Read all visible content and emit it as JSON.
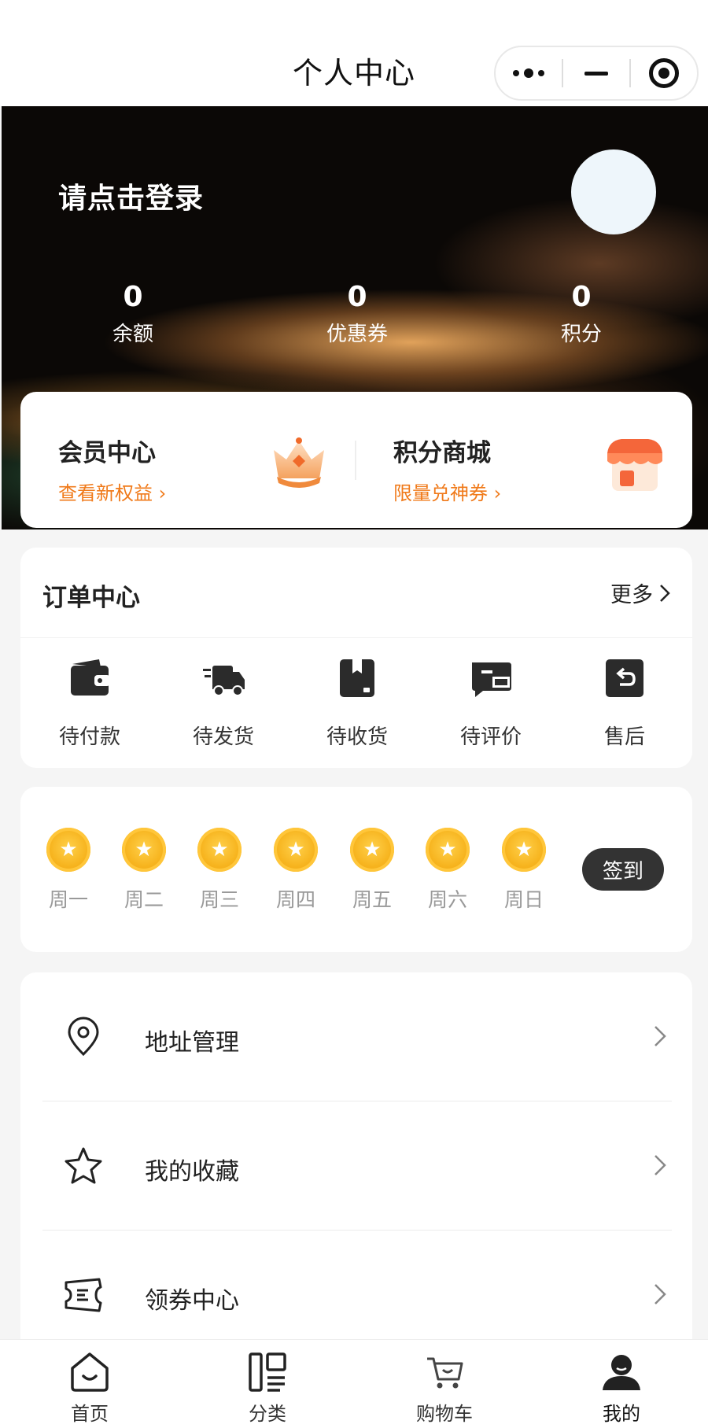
{
  "nav": {
    "title": "个人中心"
  },
  "hero": {
    "login_text": "请点击登录",
    "stats": [
      {
        "value": "0",
        "label": "余额"
      },
      {
        "value": "0",
        "label": "优惠券"
      },
      {
        "value": "0",
        "label": "积分"
      }
    ]
  },
  "member": {
    "vip": {
      "title": "会员中心",
      "subtitle": "查看新权益",
      "icon": "crown-icon"
    },
    "mall": {
      "title": "积分商城",
      "subtitle": "限量兑神券",
      "icon": "shop-icon"
    }
  },
  "orders": {
    "title": "订单中心",
    "more": "更多",
    "items": [
      {
        "label": "待付款",
        "icon": "wallet-icon"
      },
      {
        "label": "待发货",
        "icon": "truck-icon"
      },
      {
        "label": "待收货",
        "icon": "package-icon"
      },
      {
        "label": "待评价",
        "icon": "review-icon"
      },
      {
        "label": "售后",
        "icon": "return-icon"
      }
    ]
  },
  "signin": {
    "days": [
      "周一",
      "周二",
      "周三",
      "周四",
      "周五",
      "周六",
      "周日"
    ],
    "button": "签到",
    "colors": {
      "coin": "#f7b520",
      "button": "#333333"
    }
  },
  "menu": [
    {
      "label": "地址管理",
      "icon": "location-pin-icon"
    },
    {
      "label": "我的收藏",
      "icon": "star-icon"
    },
    {
      "label": "领券中心",
      "icon": "coupon-icon"
    }
  ],
  "tabbar": [
    {
      "label": "首页",
      "icon": "home-icon",
      "active": false
    },
    {
      "label": "分类",
      "icon": "category-icon",
      "active": false
    },
    {
      "label": "购物车",
      "icon": "cart-icon",
      "active": false
    },
    {
      "label": "我的",
      "icon": "user-icon",
      "active": true
    }
  ],
  "colors": {
    "accent": "#f07a1a",
    "text": "#222222",
    "background": "#f5f5f5"
  }
}
